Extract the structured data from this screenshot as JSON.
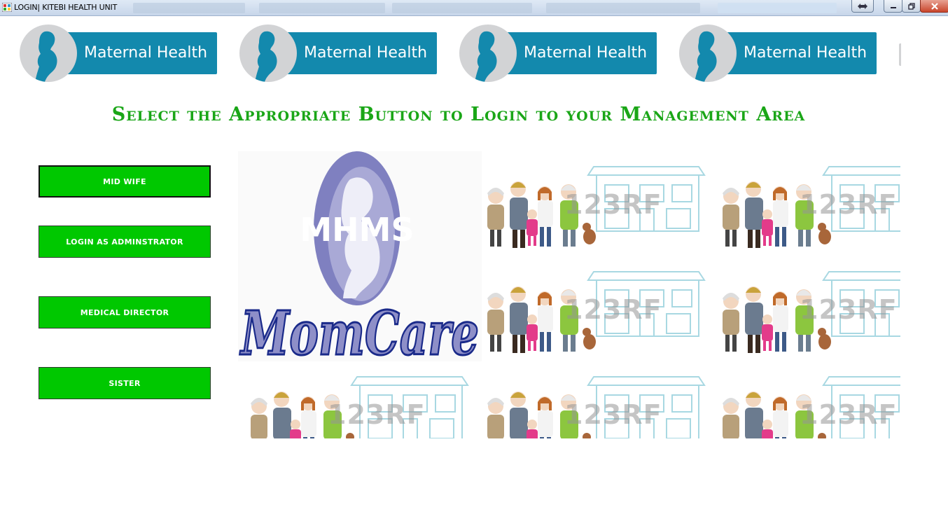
{
  "window": {
    "title": "LOGIN| KITEBI HEALTH UNIT"
  },
  "banner": {
    "label": "Maternal Health",
    "bar_color": "#1389ad"
  },
  "heading": "Select the Appropriate Button to Login to your Management Area",
  "buttons": [
    {
      "label": "MID WIFE"
    },
    {
      "label": "LOGIN AS ADMINSTRATOR"
    },
    {
      "label": "MEDICAL DIRECTOR"
    },
    {
      "label": "SISTER"
    }
  ],
  "logo": {
    "top_text": "MHMS",
    "bottom_text": "MomCare"
  },
  "tile": {
    "watermark": "123RF"
  },
  "colors": {
    "accent_green": "#1aa617",
    "button_green": "#00c800",
    "logo_purple": "#8e8fc8",
    "logo_navy": "#1a2a8a"
  }
}
